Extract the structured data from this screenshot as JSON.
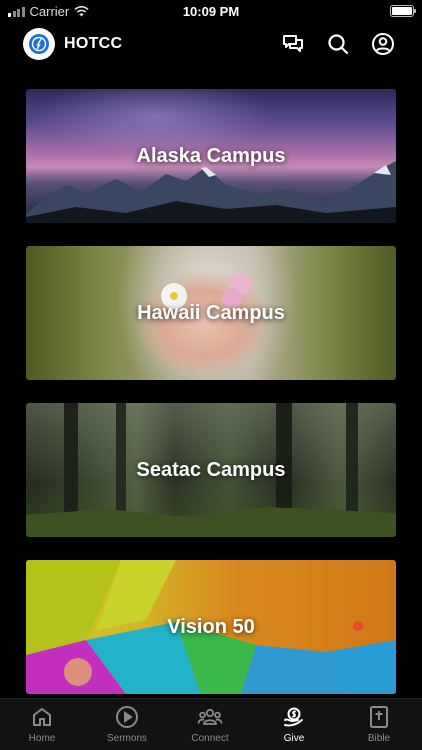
{
  "status_bar": {
    "carrier": "Carrier",
    "time": "10:09 PM"
  },
  "header": {
    "title": "HOTCC"
  },
  "campuses": [
    {
      "label": "Alaska Campus"
    },
    {
      "label": "Hawaii Campus"
    },
    {
      "label": "Seatac Campus"
    },
    {
      "label": "Vision 50"
    }
  ],
  "tabs": [
    {
      "label": "Home",
      "icon": "home-icon"
    },
    {
      "label": "Sermons",
      "icon": "play-circle-icon"
    },
    {
      "label": "Connect",
      "icon": "people-icon"
    },
    {
      "label": "Give",
      "icon": "give-icon",
      "active": true
    },
    {
      "label": "Bible",
      "icon": "bible-icon"
    }
  ]
}
